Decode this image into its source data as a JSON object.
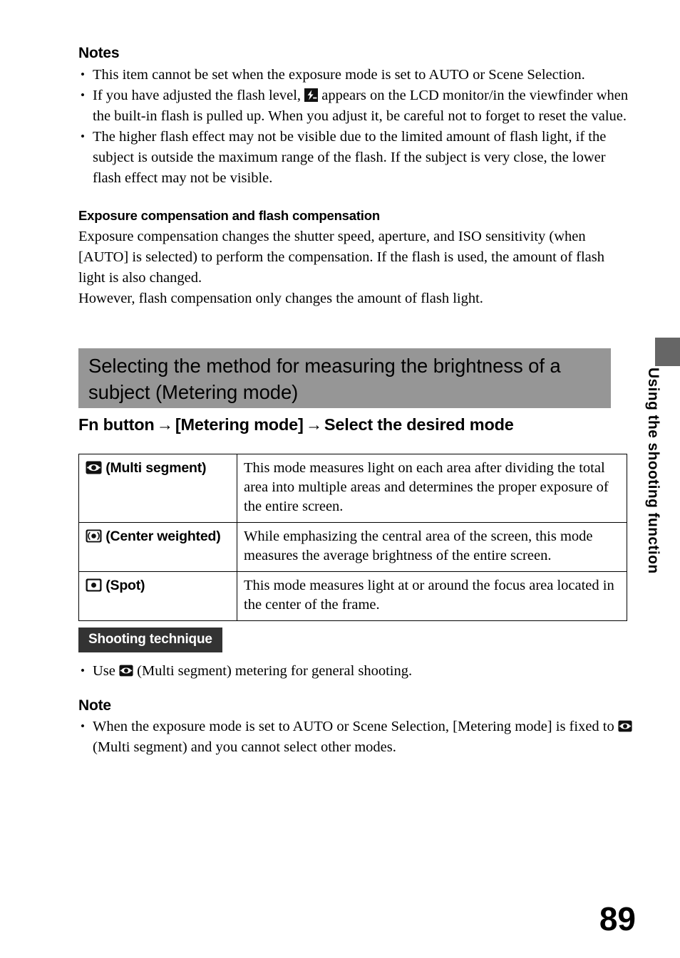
{
  "document": {
    "page_number": "89",
    "side_tab_label": "Using the shooting function"
  },
  "colors": {
    "banner_gray": "#969696",
    "side_tab_gray": "#666666",
    "badge_dark": "#333333",
    "text": "#000000",
    "page_background": "#ffffff"
  },
  "notes_section": {
    "title": "Notes",
    "bullets": {
      "b1": "This item cannot be set when the exposure mode is set to AUTO or Scene Selection.",
      "b2_pre": "If you have adjusted the flash level,",
      "b2_icon": "flash-compensation-icon",
      "b2_post": "appears on the LCD monitor/in the viewfinder when the built-in flash is pulled up. When you adjust it, be careful not to forget to reset the value.",
      "b3": "The higher flash effect may not be visible due to the limited amount of flash light, if the subject is outside the maximum range of the flash. If the subject is very close, the lower flash effect may not be visible."
    }
  },
  "exposure_section": {
    "heading": "Exposure compensation and flash compensation",
    "paragraph_1": "Exposure compensation changes the shutter speed, aperture, and ISO sensitivity (when [AUTO] is selected) to perform the compensation. If the flash is used, the amount of flash light is also changed.",
    "paragraph_2": "However, flash compensation only changes the amount of flash light."
  },
  "banner": {
    "title": "Selecting the method for measuring the brightness of a subject (Metering mode)"
  },
  "procedure": {
    "step_1": "Fn button",
    "arrow_1": "→",
    "step_2": "[Metering mode]",
    "arrow_2": "→",
    "step_3": "Select the desired mode"
  },
  "metering_table": {
    "rows": [
      {
        "icon": "multi-segment-metering-icon",
        "label": "(Multi segment)",
        "description": "This mode measures light on each area after dividing the total area into multiple areas and determines the proper exposure of the entire screen."
      },
      {
        "icon": "center-weighted-metering-icon",
        "label": "(Center weighted)",
        "description": "While emphasizing the central area of the screen, this mode measures the average brightness of the entire screen."
      },
      {
        "icon": "spot-metering-icon",
        "label": "(Spot)",
        "description": "This mode measures light at or around the focus area located in the center of the frame."
      }
    ]
  },
  "shooting_technique": {
    "badge_label": "Shooting technique",
    "bullet_pre": "Use",
    "bullet_icon": "multi-segment-metering-icon",
    "bullet_post": "(Multi segment) metering for general shooting."
  },
  "note_section": {
    "title": "Note",
    "bullet_pre": "When the exposure mode is set to AUTO or Scene Selection, [Metering mode] is fixed to",
    "bullet_icon": "multi-segment-metering-icon",
    "bullet_post": "(Multi segment) and you cannot select other modes."
  }
}
